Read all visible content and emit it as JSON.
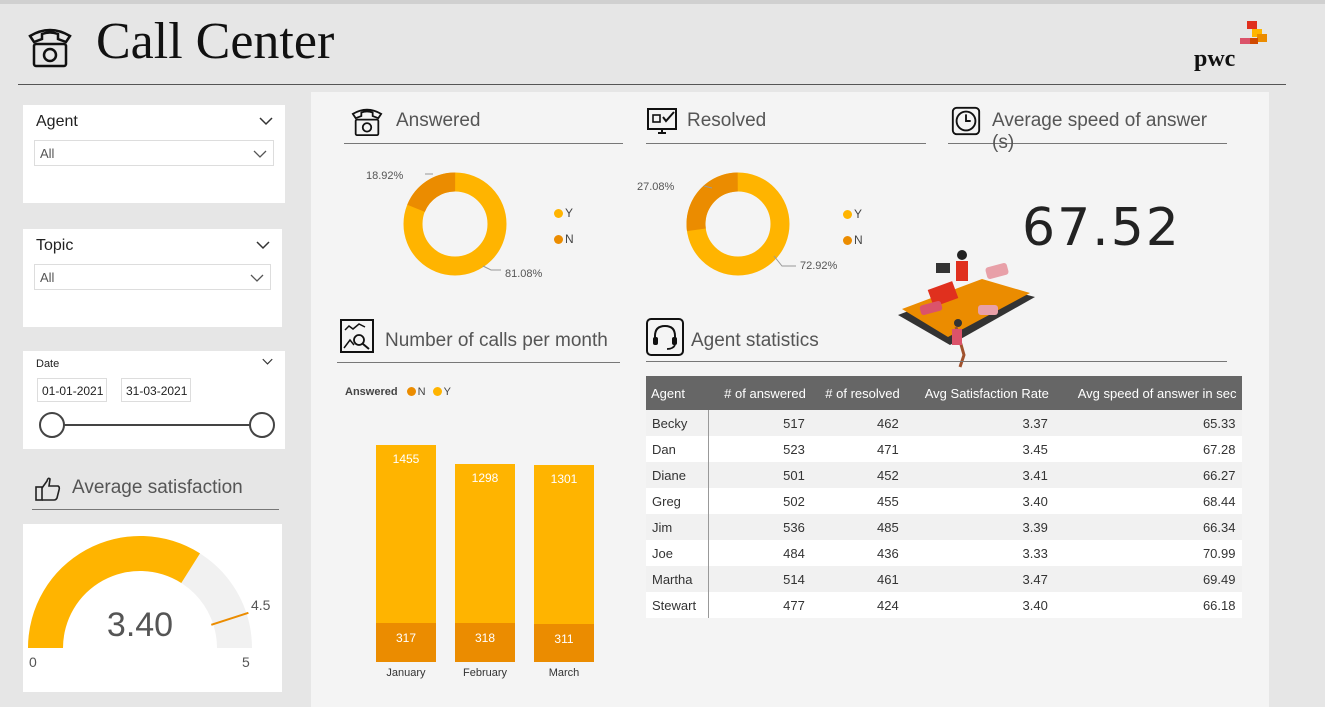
{
  "header": {
    "title": "Call Center",
    "logo_text": "pwc"
  },
  "colors": {
    "y": "#ffb400",
    "n": "#eb8c00",
    "dark": "#666666"
  },
  "filters": {
    "agent": {
      "label": "Agent",
      "value": "All"
    },
    "topic": {
      "label": "Topic",
      "value": "All"
    },
    "date": {
      "label": "Date",
      "from": "01-01-2021",
      "to": "31-03-2021"
    }
  },
  "avg_satisfaction": {
    "title": "Average satisfaction",
    "value": "3.40",
    "min": "0",
    "max": "5",
    "target": "4.5",
    "value_num": 3.4
  },
  "answered": {
    "title": "Answered",
    "pct_n": "18.92%",
    "pct_y": "81.08%",
    "legend": [
      "Y",
      "N"
    ]
  },
  "resolved": {
    "title": "Resolved",
    "pct_n": "27.08%",
    "pct_y": "72.92%",
    "legend": [
      "Y",
      "N"
    ]
  },
  "speed": {
    "title": "Average speed of answer (s)",
    "value": "67.52"
  },
  "calls": {
    "title": "Number of calls per month",
    "legend_title": "Answered",
    "legend": [
      "N",
      "Y"
    ]
  },
  "chart_data": {
    "type": "bar",
    "stacked": true,
    "categories": [
      "January",
      "February",
      "March"
    ],
    "series": [
      {
        "name": "N",
        "values": [
          317,
          318,
          311
        ]
      },
      {
        "name": "Y",
        "values": [
          1455,
          1298,
          1301
        ]
      }
    ]
  },
  "agent_stats": {
    "title": "Agent statistics",
    "columns": [
      "Agent",
      "# of answered",
      "# of resolved",
      "Avg Satisfaction Rate",
      "Avg speed of answer in sec"
    ],
    "rows": [
      [
        "Becky",
        "517",
        "462",
        "3.37",
        "65.33"
      ],
      [
        "Dan",
        "523",
        "471",
        "3.45",
        "67.28"
      ],
      [
        "Diane",
        "501",
        "452",
        "3.41",
        "66.27"
      ],
      [
        "Greg",
        "502",
        "455",
        "3.40",
        "68.44"
      ],
      [
        "Jim",
        "536",
        "485",
        "3.39",
        "66.34"
      ],
      [
        "Joe",
        "484",
        "436",
        "3.33",
        "70.99"
      ],
      [
        "Martha",
        "514",
        "461",
        "3.47",
        "69.49"
      ],
      [
        "Stewart",
        "477",
        "424",
        "3.40",
        "66.18"
      ]
    ]
  }
}
